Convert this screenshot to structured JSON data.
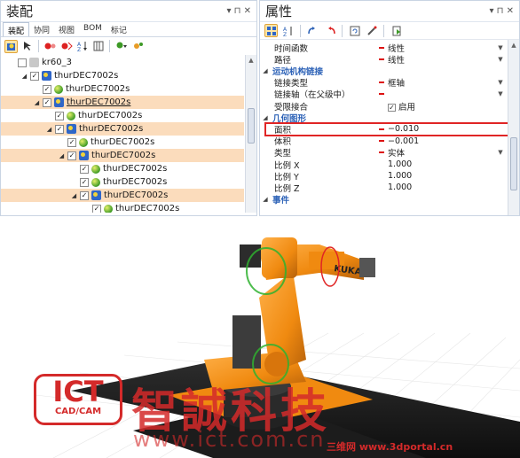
{
  "assembly_panel": {
    "title": "装配",
    "pin": "▾ ⊓ ✕",
    "tabs": [
      "装配",
      "协同",
      "视图",
      "BOM",
      "标记"
    ],
    "tree": [
      {
        "label": "kr60_3",
        "indent": 0,
        "icon": "gray-part-icon",
        "checked": false,
        "highlight": false,
        "expander": ""
      },
      {
        "label": "thurDEC7002s",
        "indent": 1,
        "icon": "assembly-icon",
        "checked": true,
        "highlight": false,
        "expander": "◢"
      },
      {
        "label": "thurDEC7002s",
        "indent": 2,
        "icon": "part-icon",
        "checked": true,
        "highlight": false,
        "expander": ""
      },
      {
        "label": "thurDEC7002s",
        "indent": 2,
        "icon": "assembly-icon",
        "checked": true,
        "highlight": true,
        "expander": "◢",
        "underline": true
      },
      {
        "label": "thurDEC7002s",
        "indent": 3,
        "icon": "part-icon",
        "checked": true,
        "highlight": false,
        "expander": ""
      },
      {
        "label": "thurDEC7002s",
        "indent": 3,
        "icon": "assembly-icon",
        "checked": true,
        "highlight": true,
        "expander": "◢"
      },
      {
        "label": "thurDEC7002s",
        "indent": 4,
        "icon": "part-icon",
        "checked": true,
        "highlight": false,
        "expander": ""
      },
      {
        "label": "thurDEC7002s",
        "indent": 4,
        "icon": "assembly-icon",
        "checked": true,
        "highlight": true,
        "expander": "◢"
      },
      {
        "label": "thurDEC7002s",
        "indent": 5,
        "icon": "part-icon",
        "checked": true,
        "highlight": false,
        "expander": ""
      },
      {
        "label": "thurDEC7002s",
        "indent": 5,
        "icon": "part-icon",
        "checked": true,
        "highlight": false,
        "expander": ""
      },
      {
        "label": "thurDEC7002s",
        "indent": 5,
        "icon": "assembly-icon",
        "checked": true,
        "highlight": true,
        "expander": "◢"
      },
      {
        "label": "thurDEC7002s",
        "indent": 6,
        "icon": "part-icon",
        "checked": true,
        "highlight": false,
        "expander": ""
      }
    ]
  },
  "properties_panel": {
    "title": "属性",
    "pin": "▾ ⊓ ✕",
    "rows": [
      {
        "type": "prop",
        "name": "时间函数",
        "value": "线性",
        "dot": true,
        "dropdown": true
      },
      {
        "type": "prop",
        "name": "路径",
        "value": "线性",
        "dot": true,
        "dropdown": true
      },
      {
        "type": "cat",
        "name": "运动机构链接"
      },
      {
        "type": "prop",
        "name": "链接类型",
        "value": "框轴",
        "dot": true,
        "dropdown": true
      },
      {
        "type": "prop",
        "name": "链接轴（在父级中）",
        "value": "",
        "dot": true,
        "dropdown": true
      },
      {
        "type": "prop",
        "name": "受限接合",
        "value": "启用",
        "dot": false,
        "dropdown": false,
        "checkbox": true
      },
      {
        "type": "cat",
        "name": "几何图形"
      },
      {
        "type": "prop",
        "name": "面积",
        "value": "−0.010",
        "dot": true,
        "dropdown": false
      },
      {
        "type": "prop",
        "name": "体积",
        "value": "−0.001",
        "dot": true,
        "dropdown": false
      },
      {
        "type": "prop",
        "name": "类型",
        "value": "实体",
        "dot": true,
        "dropdown": true
      },
      {
        "type": "prop",
        "name": "比例 X",
        "value": "1.000",
        "dot": false,
        "dropdown": false
      },
      {
        "type": "prop",
        "name": "比例 Y",
        "value": "1.000",
        "dot": false,
        "dropdown": false
      },
      {
        "type": "prop",
        "name": "比例 Z",
        "value": "1.000",
        "dot": false,
        "dropdown": false
      },
      {
        "type": "cat",
        "name": "事件"
      }
    ]
  },
  "viewport": {
    "robot_badge": "KUKA",
    "watermark_logo": "ICT",
    "watermark_sub": "CAD/CAM",
    "watermark_title": "智誠科技",
    "watermark_url": "www.ict.com.cn",
    "watermark_portal": "三维网 www.3dportal.cn"
  },
  "colors": {
    "robot_orange": "#f08a10",
    "highlight_row": "#fbdcbc",
    "accent_blue": "#2d62b7",
    "watermark_red": "#d42a2a"
  }
}
